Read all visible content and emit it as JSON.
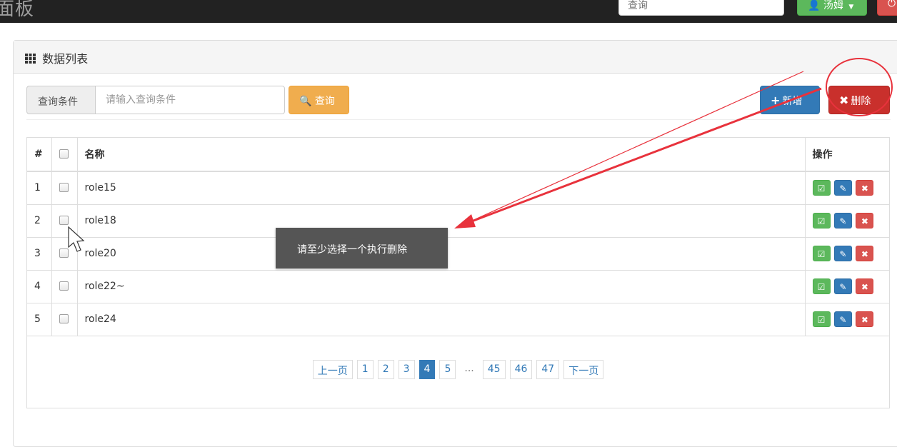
{
  "navbar": {
    "brand": "面板",
    "search_placeholder": "查询",
    "user_label": "汤姆"
  },
  "panel": {
    "title": "数据列表"
  },
  "query": {
    "addon_label": "查询条件",
    "input_placeholder": "请输入查询条件",
    "search_button": "查询"
  },
  "actions": {
    "add_label": "新增",
    "delete_label": "删除"
  },
  "table": {
    "headers": {
      "num": "#",
      "name": "名称",
      "ops": "操作"
    },
    "rows": [
      {
        "num": "1",
        "name": "role15"
      },
      {
        "num": "2",
        "name": "role18"
      },
      {
        "num": "3",
        "name": "role20"
      },
      {
        "num": "4",
        "name": "role22~"
      },
      {
        "num": "5",
        "name": "role24"
      }
    ]
  },
  "pagination": {
    "prev": "上一页",
    "pages": [
      "1",
      "2",
      "3",
      "4",
      "5",
      "...",
      "45",
      "46",
      "47"
    ],
    "active": "4",
    "next": "下一页"
  },
  "toast": {
    "message": "请至少选择一个执行删除"
  },
  "colors": {
    "primary": "#337ab7",
    "success": "#5cb85c",
    "warning": "#f0ad4e",
    "danger": "#d9534f",
    "annotation": "#e8323c"
  },
  "icons": {
    "brand_area": "none",
    "user": "user-icon",
    "search": "search-icon",
    "add": "plus-icon",
    "delete": "x-icon",
    "row_assign": "check-square-icon",
    "row_edit": "pencil-icon",
    "row_delete": "x-icon"
  }
}
